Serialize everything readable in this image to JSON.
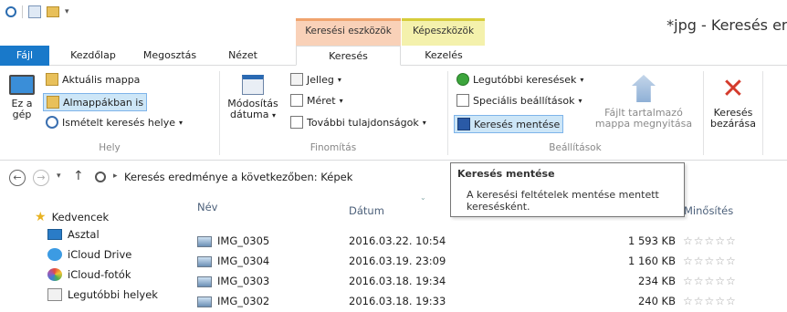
{
  "title": {
    "context_search": "Keresési eszközök",
    "context_image": "Képeszközök",
    "window_title": "*jpg - Keresés ere"
  },
  "tabs": {
    "file": "Fájl",
    "home": "Kezdőlap",
    "share": "Megosztás",
    "view": "Nézet",
    "search": "Keresés",
    "manage": "Kezelés"
  },
  "ribbon": {
    "hely": {
      "this_pc": "Ez a",
      "this_pc2": "gép",
      "current_folder": "Aktuális mappa",
      "all_subfolders": "Almappákban is",
      "search_again": "Ismételt keresés helye",
      "group": "Hely"
    },
    "finomitas": {
      "date_modified": "Módosítás",
      "date_modified2": "dátuma",
      "kind": "Jelleg",
      "size": "Méret",
      "other_props": "További tulajdonságok",
      "group": "Finomítás"
    },
    "beallitasok": {
      "recent": "Legutóbbi keresések",
      "advanced": "Speciális beállítások",
      "save": "Keresés mentése",
      "open_location": "Fájlt tartalmazó",
      "open_location2": "mappa megnyitása",
      "group": "Beállítások"
    },
    "close": {
      "label": "Keresés",
      "label2": "bezárása"
    }
  },
  "address": {
    "path": "Keresés eredménye a következőben: Képek"
  },
  "tooltip": {
    "title": "Keresés mentése",
    "body": "A keresési feltételek mentése mentett keresésként."
  },
  "nav": {
    "favorites": "Kedvencek",
    "items": [
      "Asztal",
      "iCloud Drive",
      "iCloud-fotók",
      "Legutóbbi helyek"
    ]
  },
  "columns": {
    "name": "Név",
    "date": "Dátum",
    "rating": "Minősítés"
  },
  "files": [
    {
      "name": "IMG_0305",
      "date": "2016.03.22. 10:54",
      "size": "1 593 KB",
      "rating": "☆☆☆☆☆"
    },
    {
      "name": "IMG_0304",
      "date": "2016.03.19. 23:09",
      "size": "1 160 KB",
      "rating": "☆☆☆☆☆"
    },
    {
      "name": "IMG_0303",
      "date": "2016.03.18. 19:34",
      "size": "234 KB",
      "rating": "☆☆☆☆☆"
    },
    {
      "name": "IMG_0302",
      "date": "2016.03.18. 19:33",
      "size": "240 KB",
      "rating": "☆☆☆☆☆"
    }
  ]
}
